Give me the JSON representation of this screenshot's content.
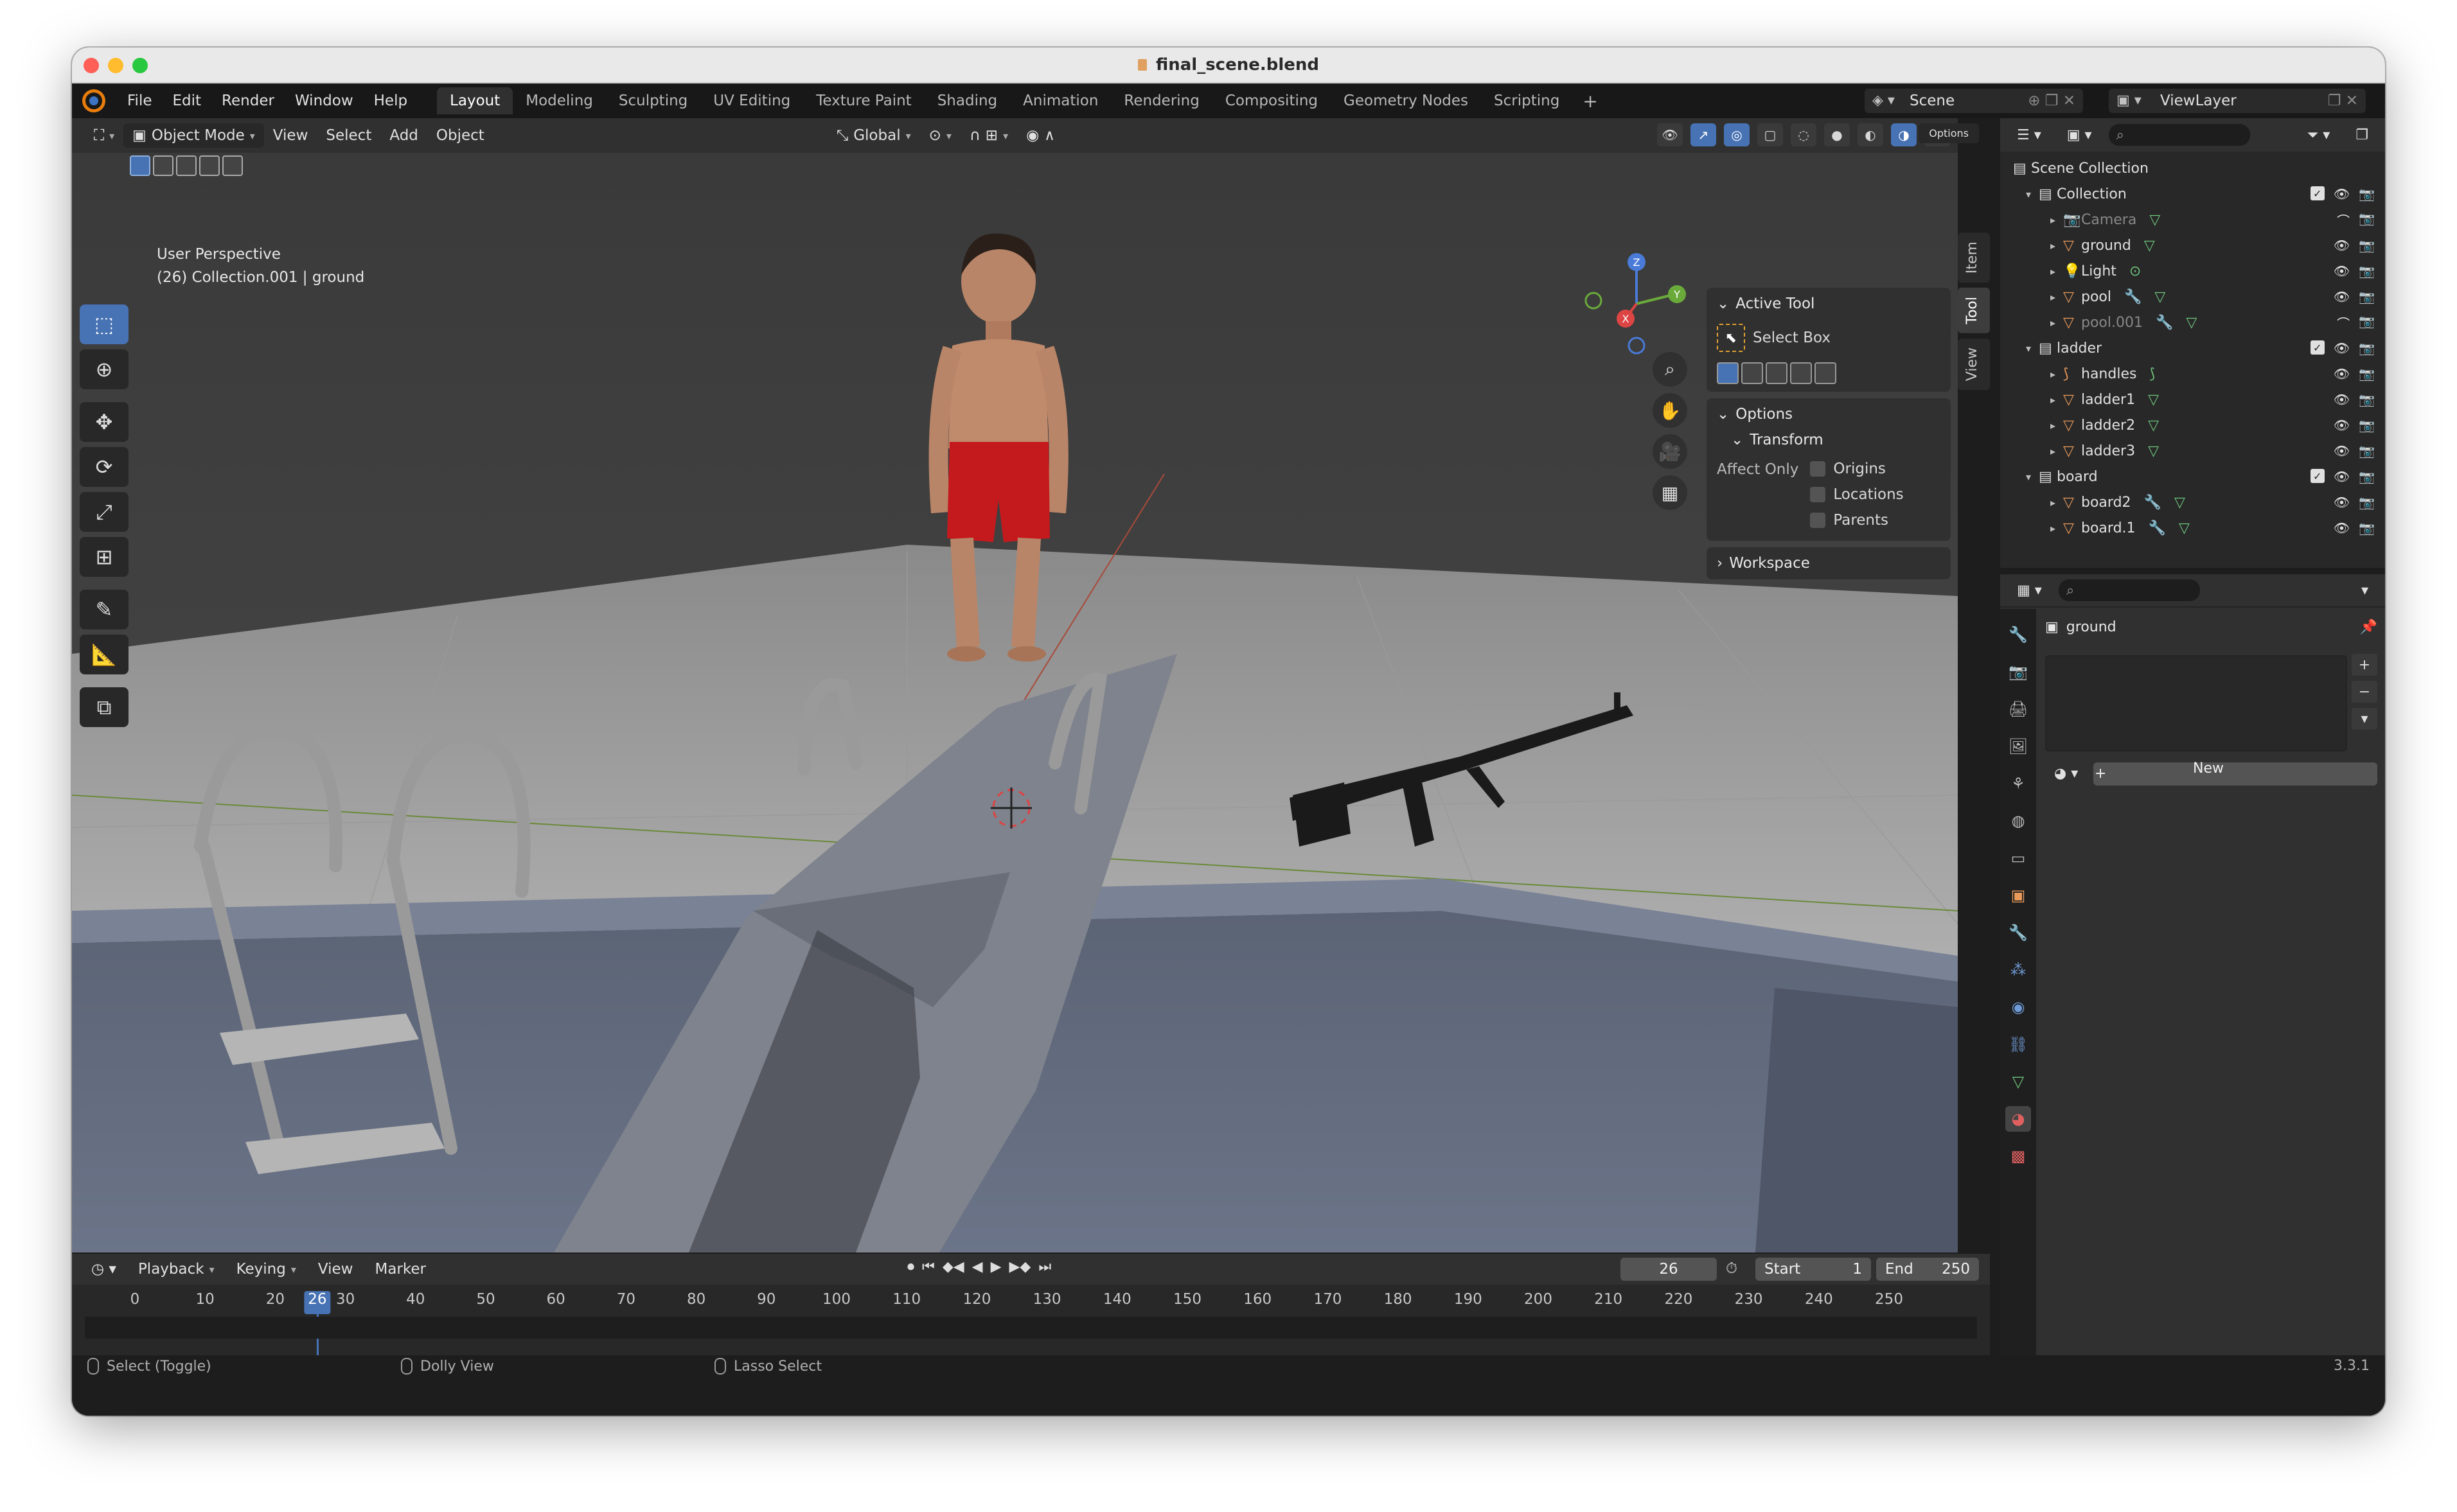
{
  "window": {
    "title": "final_scene.blend"
  },
  "menu": [
    "File",
    "Edit",
    "Render",
    "Window",
    "Help"
  ],
  "workspaces": [
    "Layout",
    "Modeling",
    "Sculpting",
    "UV Editing",
    "Texture Paint",
    "Shading",
    "Animation",
    "Rendering",
    "Compositing",
    "Geometry Nodes",
    "Scripting"
  ],
  "active_workspace": "Layout",
  "scene": {
    "name": "Scene",
    "view_layer": "ViewLayer"
  },
  "viewport_header": {
    "mode": "Object Mode",
    "menus": [
      "View",
      "Select",
      "Add",
      "Object"
    ],
    "orientation": "Global",
    "options": "Options"
  },
  "viewport": {
    "perspective": "User Perspective",
    "context": "(26) Collection.001 | ground"
  },
  "npanel": {
    "tabs": [
      "Item",
      "Tool",
      "View"
    ],
    "active_tool_title": "Active Tool",
    "active_tool": "Select Box",
    "options_title": "Options",
    "transform_title": "Transform",
    "affect_only": "Affect Only",
    "checkboxes": [
      "Origins",
      "Locations",
      "Parents"
    ],
    "workspace_title": "Workspace"
  },
  "outliner": {
    "root": "Scene Collection",
    "rows": [
      {
        "label": "Collection",
        "kind": "collection",
        "depth": 0,
        "dim": false
      },
      {
        "label": "Camera",
        "kind": "camera",
        "depth": 1,
        "dim": true
      },
      {
        "label": "ground",
        "kind": "mesh",
        "depth": 1,
        "dim": false
      },
      {
        "label": "Light",
        "kind": "light",
        "depth": 1,
        "dim": false
      },
      {
        "label": "pool",
        "kind": "mesh-mod",
        "depth": 1,
        "dim": false
      },
      {
        "label": "pool.001",
        "kind": "mesh-mod",
        "depth": 1,
        "dim": true
      },
      {
        "label": "ladder",
        "kind": "collection",
        "depth": 0,
        "dim": false
      },
      {
        "label": "handles",
        "kind": "curve",
        "depth": 1,
        "dim": false
      },
      {
        "label": "ladder1",
        "kind": "mesh",
        "depth": 1,
        "dim": false
      },
      {
        "label": "ladder2",
        "kind": "mesh",
        "depth": 1,
        "dim": false
      },
      {
        "label": "ladder3",
        "kind": "mesh",
        "depth": 1,
        "dim": false
      },
      {
        "label": "board",
        "kind": "collection",
        "depth": 0,
        "dim": false
      },
      {
        "label": "board2",
        "kind": "mesh-mod",
        "depth": 1,
        "dim": false
      },
      {
        "label": "board.1",
        "kind": "mesh-mod",
        "depth": 1,
        "dim": false
      }
    ]
  },
  "properties": {
    "object_name": "ground",
    "new_label": "New"
  },
  "timeline": {
    "menus": [
      "Playback",
      "Keying",
      "View",
      "Marker"
    ],
    "current_frame": "26",
    "start_label": "Start",
    "start": "1",
    "end_label": "End",
    "end": "250",
    "ticks": [
      "0",
      "10",
      "20",
      "30",
      "40",
      "50",
      "60",
      "70",
      "80",
      "90",
      "100",
      "110",
      "120",
      "130",
      "140",
      "150",
      "160",
      "170",
      "180",
      "190",
      "200",
      "210",
      "220",
      "230",
      "240",
      "250"
    ]
  },
  "status": {
    "items": [
      "Select (Toggle)",
      "Dolly View",
      "Lasso Select"
    ],
    "version": "3.3.1"
  }
}
